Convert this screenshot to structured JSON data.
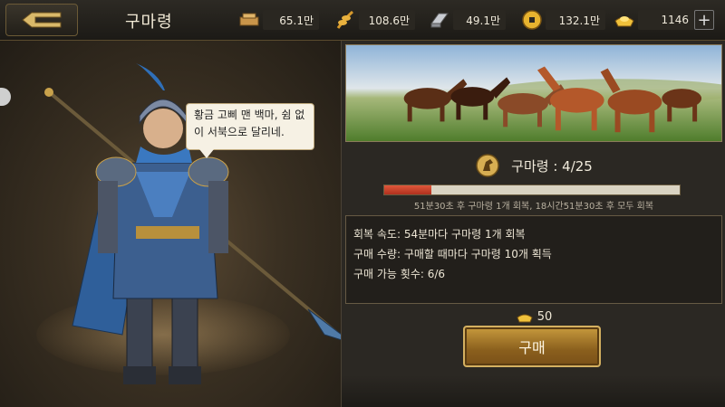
{
  "header": {
    "title": "구마령",
    "resources": [
      {
        "icon": "ration-icon",
        "value": "65.1만"
      },
      {
        "icon": "grain-icon",
        "value": "108.6만"
      },
      {
        "icon": "iron-icon",
        "value": "49.1만"
      },
      {
        "icon": "coin-icon",
        "value": "132.1만"
      },
      {
        "icon": "gold-ingot-icon",
        "value": "1146"
      }
    ],
    "plus_label": "+"
  },
  "hero": {
    "speech": "황금 고삐 맨 백마, 쉼 없이 서북으로 달리네."
  },
  "panel": {
    "count_label": "구마령 : 4/25",
    "progress_fraction": 0.16,
    "recover_text": "51분30초 후 구마령 1개 회복, 18시간51분30초 후 모두 회복",
    "info": [
      "회복 속도: 54분마다 구마령 1개 회복",
      "구매 수량: 구매할 때마다 구마령 10개 획득",
      "구매 가능 횟수: 6/6"
    ],
    "cost": "50",
    "buy_label": "구매"
  },
  "colors": {
    "accent_gold": "#c79a3d",
    "progress_red": "#c8402a"
  }
}
